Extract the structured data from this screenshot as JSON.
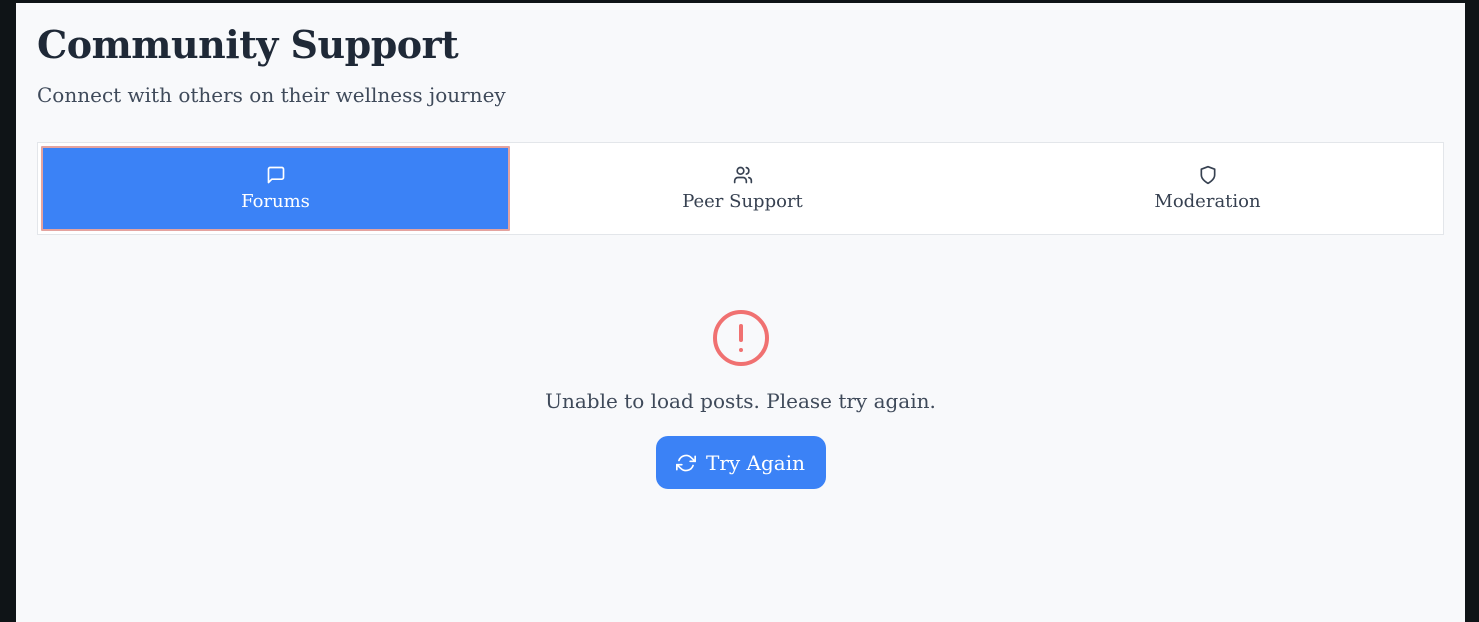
{
  "header": {
    "title": "Community Support",
    "subtitle": "Connect with others on their wellness journey"
  },
  "tabs": [
    {
      "label": "Forums",
      "icon": "message-square-icon",
      "active": true
    },
    {
      "label": "Peer Support",
      "icon": "users-icon",
      "active": false
    },
    {
      "label": "Moderation",
      "icon": "shield-icon",
      "active": false
    }
  ],
  "error": {
    "icon": "alert-circle-icon",
    "message": "Unable to load posts. Please try again.",
    "retry_label": "Try Again",
    "retry_icon": "refresh-icon"
  },
  "colors": {
    "accent": "#3b82f6",
    "error": "#f07171",
    "background": "#f8f9fb"
  }
}
